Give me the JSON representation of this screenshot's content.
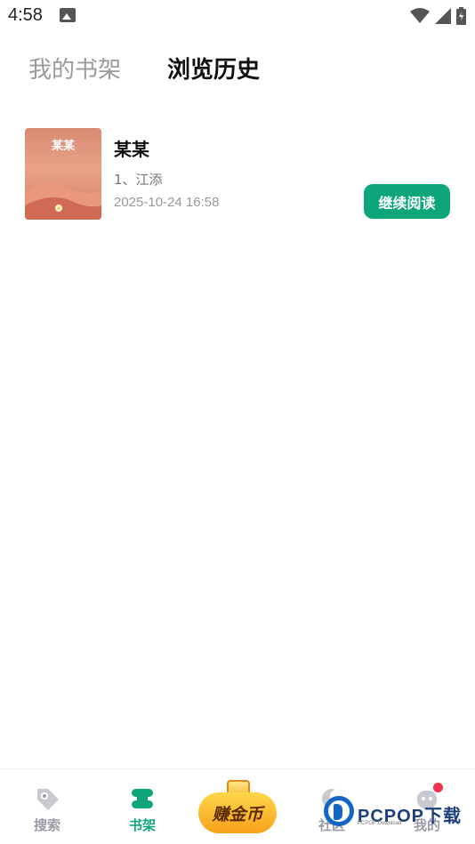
{
  "status_bar": {
    "time": "4:58"
  },
  "tabs": [
    {
      "label": "我的书架",
      "active": false
    },
    {
      "label": "浏览历史",
      "active": true
    }
  ],
  "history": [
    {
      "cover_title": "某某",
      "title": "某某",
      "chapter": "1、江添",
      "time": "2025-10-24 16:58",
      "action_label": "继续阅读"
    }
  ],
  "bottom_nav": {
    "search_label": "搜索",
    "shelf_label": "书架",
    "earn_label": "赚金币",
    "community_label": "社区",
    "mine_label": "我的"
  },
  "watermark": {
    "text": "PCPOP下载",
    "sub": "PCPOP Download"
  },
  "colors": {
    "accent": "#0ea57a",
    "inactive": "#9a9aa8",
    "badge": "#f0334f"
  }
}
